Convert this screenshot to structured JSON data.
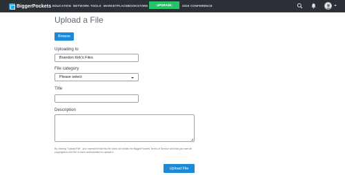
{
  "header": {
    "logo_text": "BiggerPockets",
    "nav": [
      {
        "label": "EDUCATION"
      },
      {
        "label": "NETWORK"
      },
      {
        "label": "TOOLS"
      },
      {
        "label": "MARKETPLACE"
      },
      {
        "label": "BOOKSTORE"
      }
    ],
    "upgrade_label": "UPGRADE",
    "conference_label": "2019 CONFERENCE",
    "icons": [
      "search-icon",
      "bell-icon",
      "settings-icon",
      "avatar"
    ],
    "colors": {
      "bar": "#2b2f36",
      "upgrade": "#27c26a"
    }
  },
  "page": {
    "title": "Upload a File",
    "browse_label": "Browse",
    "uploading_to_label": "Uploading to",
    "uploading_to_value": "Brandon Kirk's Files",
    "category_label": "File category",
    "category_selected": "Please select",
    "title_label": "Title",
    "title_value": "",
    "description_label": "Description",
    "description_value": "",
    "disclaimer": "By clicking \"Upload File\", you represent that this file does not violate the BiggerPockets Terms of Service and that you own all copyrights to the file or have authorization to upload it.",
    "upload_label": "Upload File",
    "colors": {
      "accent": "#1a8ad8"
    }
  }
}
